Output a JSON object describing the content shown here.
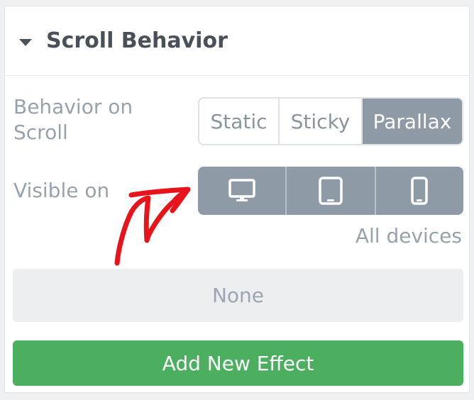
{
  "section": {
    "title": "Scroll Behavior"
  },
  "scroll_behavior": {
    "label": "Behavior on Scroll",
    "options": [
      "Static",
      "Sticky",
      "Parallax"
    ],
    "selected": "Parallax"
  },
  "visibility": {
    "label": "Visible on",
    "devices": [
      "desktop-icon",
      "tablet-icon",
      "mobile-icon"
    ],
    "caption": "All devices"
  },
  "effects": {
    "empty_value": "None",
    "add_label": "Add New Effect"
  },
  "colors": {
    "accent_green": "#4caf60",
    "segment_active": "#8e9aa6",
    "annotation_red": "#e8141c"
  }
}
